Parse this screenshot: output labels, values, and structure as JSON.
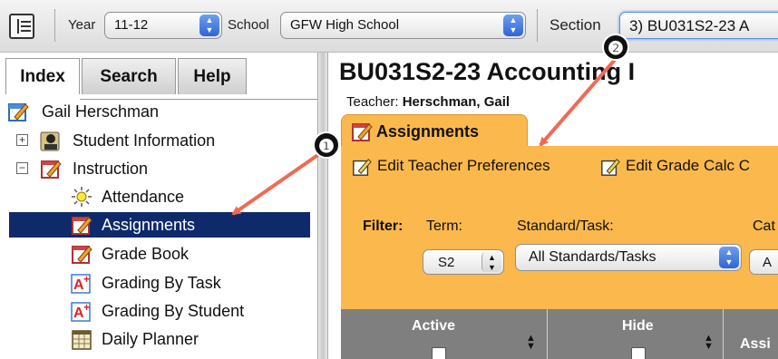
{
  "toolbar": {
    "year_label": "Year",
    "year_value": "11-12",
    "school_label": "School",
    "school_value": "GFW High School",
    "section_label": "Section",
    "section_value": "3) BU031S2-23 A"
  },
  "left_tabs": [
    {
      "label": "Index"
    },
    {
      "label": "Search"
    },
    {
      "label": "Help"
    }
  ],
  "tree": {
    "user": "Gail Herschman",
    "student_info": "Student Information",
    "instruction": "Instruction",
    "items": [
      {
        "label": "Attendance"
      },
      {
        "label": "Assignments"
      },
      {
        "label": "Grade Book"
      },
      {
        "label": "Grading By Task"
      },
      {
        "label": "Grading By Student"
      },
      {
        "label": "Daily Planner"
      }
    ]
  },
  "main": {
    "course_title": "BU031S2-23 Accounting I",
    "teacher_label": "Teacher:",
    "teacher_name": "Herschman, Gail",
    "tab_label": "Assignments",
    "link_prefs": "Edit Teacher Preferences",
    "link_gradecalc": "Edit Grade Calc C",
    "filter_label": "Filter:",
    "term_label": "Term:",
    "term_value": "S2",
    "standard_label": "Standard/Task:",
    "standard_value": "All Standards/Tasks",
    "cat_label": "Cat",
    "cat_value": "A",
    "col_active": "Active",
    "col_hide": "Hide",
    "col_assign": "Assi"
  },
  "annotations": {
    "badge_1": "❶",
    "badge_2": "❷"
  },
  "colors": {
    "accent_orange": "#fbb84d",
    "selection_navy": "#0f2a6b",
    "arrow_red": "#f06a52",
    "grid_header": "#7f7f7f"
  }
}
